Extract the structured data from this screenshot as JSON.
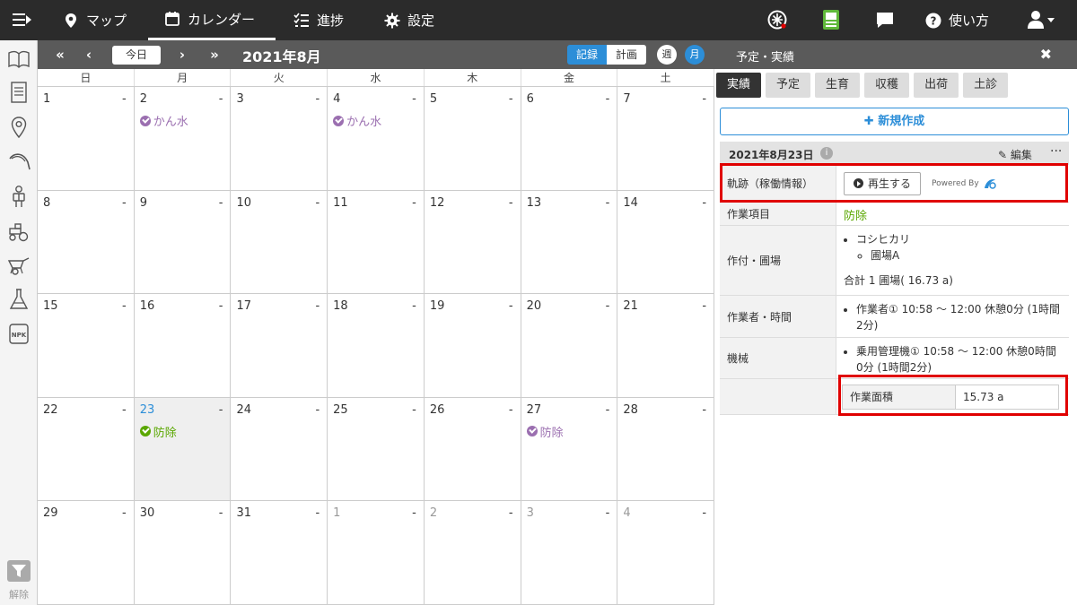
{
  "nav": {
    "items": [
      {
        "label": "マップ",
        "icon": "map-pin-icon"
      },
      {
        "label": "カレンダー",
        "icon": "calendar-icon"
      },
      {
        "label": "進捗",
        "icon": "checklist-icon"
      },
      {
        "label": "設定",
        "icon": "gear-icon"
      }
    ],
    "help_label": "使い方"
  },
  "sidebar": {
    "filter_label": "解除"
  },
  "calendar": {
    "today_label": "今日",
    "month_title": "2021年8月",
    "record_label": "記録",
    "plan_label": "計画",
    "week_label": "週",
    "month_label": "月",
    "weekdays": [
      "日",
      "月",
      "火",
      "水",
      "木",
      "金",
      "土"
    ],
    "weeks": [
      [
        {
          "n": "1",
          "d": "-"
        },
        {
          "n": "2",
          "d": "-",
          "e": "かん水",
          "ec": "purple"
        },
        {
          "n": "3",
          "d": "-"
        },
        {
          "n": "4",
          "d": "-",
          "e": "かん水",
          "ec": "purple"
        },
        {
          "n": "5",
          "d": "-"
        },
        {
          "n": "6",
          "d": "-"
        },
        {
          "n": "7",
          "d": "-"
        }
      ],
      [
        {
          "n": "8",
          "d": "-"
        },
        {
          "n": "9",
          "d": "-"
        },
        {
          "n": "10",
          "d": "-"
        },
        {
          "n": "11",
          "d": "-"
        },
        {
          "n": "12",
          "d": "-"
        },
        {
          "n": "13",
          "d": "-"
        },
        {
          "n": "14",
          "d": "-"
        }
      ],
      [
        {
          "n": "15",
          "d": "-"
        },
        {
          "n": "16",
          "d": "-"
        },
        {
          "n": "17",
          "d": "-"
        },
        {
          "n": "18",
          "d": "-"
        },
        {
          "n": "19",
          "d": "-"
        },
        {
          "n": "20",
          "d": "-"
        },
        {
          "n": "21",
          "d": "-"
        }
      ],
      [
        {
          "n": "22",
          "d": "-"
        },
        {
          "n": "23",
          "d": "-",
          "e": "防除",
          "ec": "green",
          "today": true
        },
        {
          "n": "24",
          "d": "-"
        },
        {
          "n": "25",
          "d": "-"
        },
        {
          "n": "26",
          "d": "-"
        },
        {
          "n": "27",
          "d": "-",
          "e": "防除",
          "ec": "purple"
        },
        {
          "n": "28",
          "d": "-"
        }
      ],
      [
        {
          "n": "29",
          "d": "-"
        },
        {
          "n": "30",
          "d": "-"
        },
        {
          "n": "31",
          "d": "-"
        },
        {
          "n": "1",
          "d": "-",
          "other": true
        },
        {
          "n": "2",
          "d": "-",
          "other": true
        },
        {
          "n": "3",
          "d": "-",
          "other": true
        },
        {
          "n": "4",
          "d": "-",
          "other": true
        }
      ]
    ]
  },
  "colors": {
    "purple": "#9b6fb0",
    "green": "#5aa700",
    "accent": "#2c8ed8",
    "highlight": "#e00000"
  },
  "panel": {
    "title": "予定・実績",
    "close": "✖",
    "tabs": [
      "実績",
      "予定",
      "生育",
      "収穫",
      "出荷",
      "土診"
    ],
    "new_label": "新規作成",
    "date": "2021年8月23日",
    "info": "i",
    "edit_label": "編集",
    "more": "···",
    "track_label": "軌跡（稼働情報）",
    "play_label": "再生する",
    "powered_by": "Powered By",
    "task_label": "作業項目",
    "task_value": "防除",
    "crop_label": "作付・圃場",
    "crop_name": "コシヒカリ",
    "field_name": "圃場A",
    "crop_total": "合計 1 圃場( 16.73 a)",
    "worker_label": "作業者・時間",
    "worker_value": "作業者① 10:58 〜 12:00 休憩0分 (1時間2分)",
    "machine_label": "機械",
    "machine_value": "乗用管理機① 10:58 〜 12:00 休憩0時間0分 (1時間2分)",
    "area_label": "作業面積",
    "area_value": "15.73 a"
  }
}
